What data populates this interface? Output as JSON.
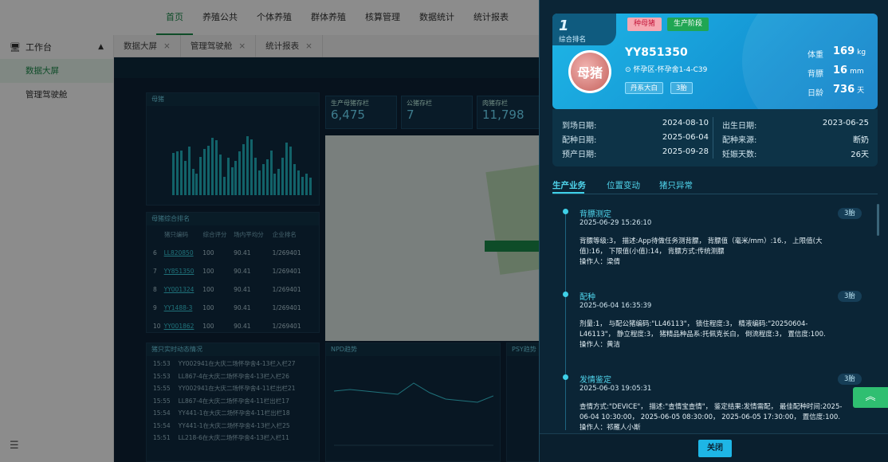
{
  "topnav": [
    {
      "label": "首页",
      "active": true
    },
    {
      "label": "养殖公共"
    },
    {
      "label": "个体养殖"
    },
    {
      "label": "群体养殖"
    },
    {
      "label": "核算管理"
    },
    {
      "label": "数据统计"
    },
    {
      "label": "统计报表"
    }
  ],
  "sidebar": {
    "group": "工作台",
    "items": [
      {
        "label": "数据大屏",
        "active": true
      },
      {
        "label": "管理驾驶舱"
      }
    ]
  },
  "tabs": [
    {
      "label": "数据大屏"
    },
    {
      "label": "管理驾驶舱"
    },
    {
      "label": "统计报表"
    }
  ],
  "dashboard": {
    "panel_left_title": "母猪",
    "stats": [
      {
        "label": "生产母猪存栏",
        "value": "6,475"
      },
      {
        "label": "公猪存栏",
        "value": "7"
      },
      {
        "label": "肉猪存栏",
        "value": "11,798"
      }
    ],
    "rank_title": "母猪综合排名",
    "rank_headers": [
      "猪只编码",
      "综合评分",
      "场内平均分",
      "企业排名"
    ],
    "rank_rows": [
      {
        "no": "6",
        "id": "LL820850",
        "score": "100",
        "avg": "90.41",
        "rank": "1/269401"
      },
      {
        "no": "7",
        "id": "YY851350",
        "score": "100",
        "avg": "90.41",
        "rank": "1/269401"
      },
      {
        "no": "8",
        "id": "YY001324",
        "score": "100",
        "avg": "90.41",
        "rank": "1/269401"
      },
      {
        "no": "9",
        "id": "YY1488-3",
        "score": "100",
        "avg": "90.41",
        "rank": "1/269401"
      },
      {
        "no": "10",
        "id": "YY001862",
        "score": "100",
        "avg": "90.41",
        "rank": "1/269401"
      }
    ],
    "events_title": "猪只实时动态情况",
    "events": [
      {
        "time": "15:53",
        "text": "YY002941在大庆二场怀孕舍4-13栏入栏27"
      },
      {
        "time": "15:53",
        "text": "LL867-4在大庆二场怀孕舍4-13栏入栏26"
      },
      {
        "time": "15:55",
        "text": "YY002941在大庆二场怀孕舍4-11栏出栏21"
      },
      {
        "time": "15:55",
        "text": "LL867-4在大庆二场怀孕舍4-11栏出栏17"
      },
      {
        "time": "15:54",
        "text": "YY441-1在大庆二场怀孕舍4-11栏出栏18"
      },
      {
        "time": "15:54",
        "text": "YY441-1在大庆二场怀孕舍4-13栏入栏25"
      },
      {
        "time": "15:51",
        "text": "LL218-6在大庆二场怀孕舍4-13栏入栏11"
      }
    ],
    "npd_title": "NPD趋势",
    "psy_title": "PSY趋势",
    "bars": [
      0.68,
      0.7,
      0.72,
      0.55,
      0.78,
      0.42,
      0.35,
      0.62,
      0.75,
      0.8,
      0.92,
      0.88,
      0.65,
      0.3,
      0.6,
      0.45,
      0.55,
      0.7,
      0.82,
      0.95,
      0.9,
      0.6,
      0.4,
      0.5,
      0.58,
      0.72,
      0.35,
      0.42,
      0.6,
      0.85,
      0.78,
      0.5,
      0.4,
      0.3,
      0.35,
      0.28
    ]
  },
  "drawer": {
    "rank_no": "1",
    "rank_label": "综合排名",
    "chip_sow": "种母猪",
    "chip_stage": "生产阶段",
    "avatar_text": "母猪",
    "pig_id": "YY851350",
    "location": "怀孕区-怀孕舍1-4-C39",
    "breed": "丹系大白",
    "parity": "3胎",
    "metrics": [
      {
        "label": "体重",
        "value": "169",
        "unit": "kg"
      },
      {
        "label": "背膘",
        "value": "16",
        "unit": "mm"
      },
      {
        "label": "日龄",
        "value": "736",
        "unit": "天"
      }
    ],
    "info_left": [
      {
        "label": "到场日期:",
        "value": "2024-08-10"
      },
      {
        "label": "配种日期:",
        "value": "2025-06-04"
      },
      {
        "label": "预产日期:",
        "value": "2025-09-28"
      }
    ],
    "info_right": [
      {
        "label": "出生日期:",
        "value": "2023-06-25"
      },
      {
        "label": "配种来源:",
        "value": "断奶"
      },
      {
        "label": "妊娠天数:",
        "value": "26天"
      }
    ],
    "tabs": [
      "生产业务",
      "位置变动",
      "猪只异常"
    ],
    "timeline": [
      {
        "title": "背膘测定",
        "badge": "3胎",
        "time": "2025-06-29 15:26:10",
        "desc": [
          "背膘等级:3， 描述:App待做任务测背膘， 背膘值（毫米/mm）:16.， 上限值(大值):16， 下限值(小值):14， 背膘方式:传统测膘",
          "操作人：梁倩"
        ]
      },
      {
        "title": "配种",
        "badge": "3胎",
        "time": "2025-06-04 16:35:39",
        "desc": [
          "剂量:1， 与配公猪编码:\"LL46113\"， 锁住程度:3， 精液编码:\"20250604-L46113\"， 静立程度:3， 猪精品种品系:托佩克长白， 倒流程度:3， 置信度:100.",
          "操作人：黄洁"
        ]
      },
      {
        "title": "发情鉴定",
        "badge": "3胎",
        "time": "2025-06-03 19:05:31",
        "desc": [
          "查情方式:\"DEVICE\"， 描述:\"查情宝查情\"， 鉴定结果:发情需配， 最佳配种时间:2025-06-04 10:30:00， 2025-06-05 08:30:00， 2025-06-05 17:30:00， 置信度:100.",
          "操作人：祁雁人小斯"
        ]
      }
    ],
    "close_label": "关闭"
  },
  "icons": {
    "sidebar": "desktop-icon",
    "collapse": "menu-fold-icon",
    "totop": "double-chevron-up-icon",
    "location": "location-pin-icon"
  }
}
